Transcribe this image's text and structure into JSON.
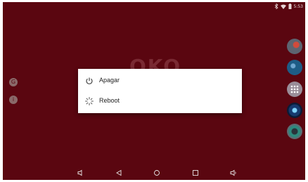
{
  "status_bar": {
    "left_text": "",
    "time": "5:53"
  },
  "wallpaper": {
    "logo_text": "OKO"
  },
  "power_menu": {
    "items": [
      {
        "label": "Apagar",
        "icon": "power-icon"
      },
      {
        "label": "Reboot",
        "icon": "reboot-spinner-icon"
      }
    ]
  },
  "left_icons": [
    "g-icon",
    "info-icon"
  ],
  "dock_apps": [
    "app-icon",
    "app-icon",
    "app-drawer-icon",
    "app-icon",
    "settings-icon"
  ],
  "navigation": [
    "volume-down-icon",
    "back-icon",
    "home-icon",
    "recents-icon",
    "volume-up-icon"
  ],
  "colors": {
    "wallpaper": "#5a0610",
    "dialog": "#ffffff"
  }
}
